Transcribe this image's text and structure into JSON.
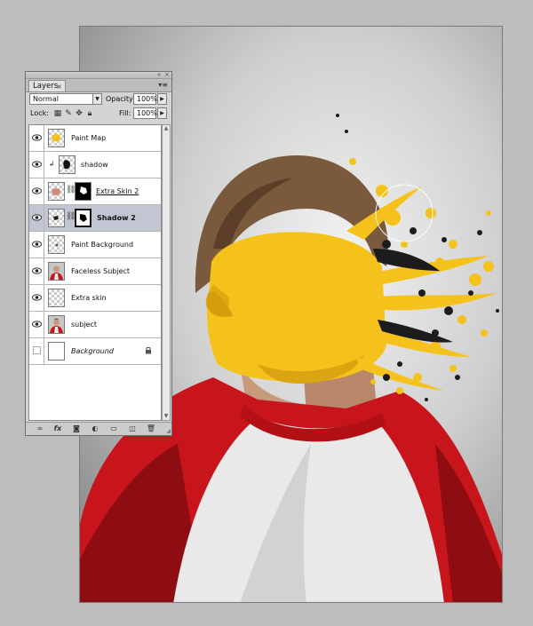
{
  "panel": {
    "tab_label": "Layers",
    "tab_close": "×",
    "title_collapse": "«",
    "title_close": "×",
    "menu_icon": "▾≡",
    "blend_mode": "Normal",
    "opacity_label": "Opacity:",
    "opacity_value": "100%",
    "lock_label": "Lock:",
    "fill_label": "Fill:",
    "fill_value": "100%"
  },
  "layers": [
    {
      "name": "Paint Map",
      "visible": true,
      "thumb": "yellow-blob"
    },
    {
      "name": "shadow",
      "visible": true,
      "thumb": "mask-dark",
      "clipped": true
    },
    {
      "name": "Extra Skin 2",
      "visible": true,
      "thumb": "skin-with-mask",
      "linked_mask": true
    },
    {
      "name": "Shadow 2",
      "visible": true,
      "thumb": "shadow-with-mask",
      "selected": true
    },
    {
      "name": "Paint Background",
      "visible": true,
      "thumb": "transparent-small"
    },
    {
      "name": "Faceless Subject",
      "visible": true,
      "thumb": "portrait"
    },
    {
      "name": "Extra skin",
      "visible": true,
      "thumb": "transparent"
    },
    {
      "name": "subject",
      "visible": true,
      "thumb": "portrait"
    },
    {
      "name": "Background",
      "visible": false,
      "thumb": "white",
      "locked": true
    }
  ],
  "bottom_icons": [
    "link-icon",
    "fx-icon",
    "mask-icon",
    "adjustment-icon",
    "group-folder-icon",
    "new-layer-icon",
    "trash-icon"
  ],
  "bottom_labels": {
    "fx": "fx"
  },
  "colors": {
    "paint_yellow": "#f5c21c",
    "shirt_red": "#c8141b",
    "shirt_white": "#e9e9e9",
    "selected_row": "#c2c6d2"
  }
}
